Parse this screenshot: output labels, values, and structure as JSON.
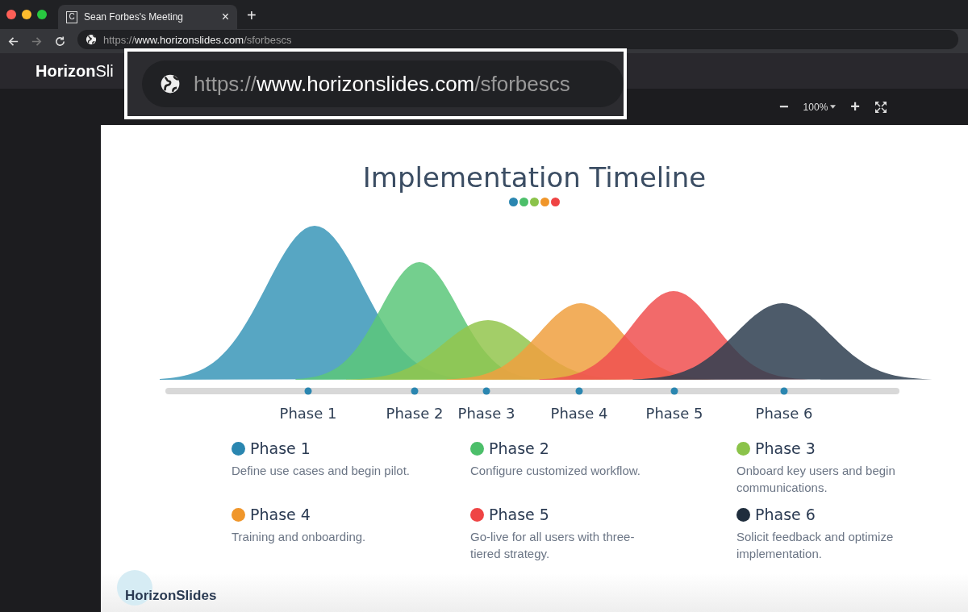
{
  "browser": {
    "tab": {
      "favicon_letter": "C",
      "title": "Sean Forbes's Meeting",
      "close": "×",
      "selected": true
    },
    "new_tab": "+",
    "address": {
      "scheme": "https://",
      "host": "www.horizonslides.com",
      "path": "/sforbescs"
    }
  },
  "app_header": {
    "logo": "**Horizon**Sli"
  },
  "callout": {
    "scheme": "https://",
    "host": "www.horizonslides.com",
    "path": "/sforbescs"
  },
  "toolbar": {
    "zoom_out": "−",
    "zoom": "100%",
    "zoom_in": "+"
  },
  "slide": {
    "title": "Implementation Timeline",
    "title_dots": [
      {
        "color": "#2a86b0"
      },
      {
        "color": "#4cbf6a"
      },
      {
        "color": "#8bc34a"
      },
      {
        "color": "#f0962a"
      },
      {
        "color": "#ef4444"
      }
    ],
    "timeline_labels": [
      "Phase 1",
      "Phase 2",
      "Phase 3",
      "Phase 4",
      "Phase 5",
      "Phase 6"
    ],
    "phases": [
      {
        "name": "Phase 1",
        "description": "Define use cases and begin pilot.",
        "color": "#2a86b0"
      },
      {
        "name": "Phase 2",
        "description": "Configure customized workflow.",
        "color": "#4cbf6a"
      },
      {
        "name": "Phase 3",
        "description": "Onboard key users and begin communications.",
        "color": "#8bc34a"
      },
      {
        "name": "Phase 4",
        "description": "Training and onboarding.",
        "color": "#f0962a"
      },
      {
        "name": "Phase 5",
        "description": "Go-live for all users with three-tiered strategy.",
        "color": "#ef4444"
      },
      {
        "name": "Phase 6",
        "description": "Solicit feedback and optimize implementation.",
        "color": "#1f2d3d"
      }
    ],
    "footer_logo": "HorizonSlides"
  }
}
